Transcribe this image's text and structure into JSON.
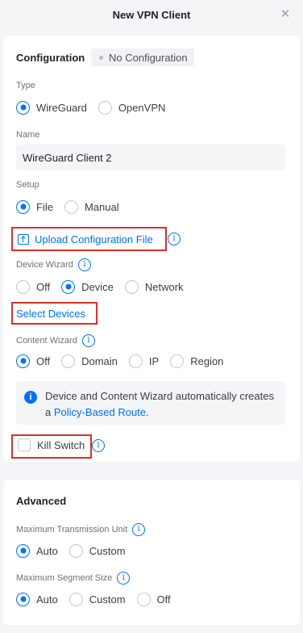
{
  "header": {
    "title": "New VPN Client",
    "close_icon": "close-icon"
  },
  "configuration": {
    "title": "Configuration",
    "status": "No Configuration",
    "type": {
      "label": "Type",
      "options": [
        "WireGuard",
        "OpenVPN"
      ],
      "selected": "WireGuard"
    },
    "name": {
      "label": "Name",
      "value": "WireGuard Client 2"
    },
    "setup": {
      "label": "Setup",
      "options": [
        "File",
        "Manual"
      ],
      "selected": "File"
    },
    "upload_link": "Upload Configuration File",
    "device_wizard": {
      "label": "Device Wizard",
      "options": [
        "Off",
        "Device",
        "Network"
      ],
      "selected": "Device"
    },
    "select_devices_link": "Select Devices",
    "content_wizard": {
      "label": "Content Wizard",
      "options": [
        "Off",
        "Domain",
        "IP",
        "Region"
      ],
      "selected": "Off"
    },
    "note": {
      "text": "Device and Content Wizard automatically creates a",
      "link": "Policy-Based Route",
      "end": "."
    },
    "kill_switch": {
      "label": "Kill Switch",
      "checked": false
    }
  },
  "advanced": {
    "title": "Advanced",
    "mtu": {
      "label": "Maximum Transmission Unit",
      "options": [
        "Auto",
        "Custom"
      ],
      "selected": "Auto"
    },
    "mss": {
      "label": "Maximum Segment Size",
      "options": [
        "Auto",
        "Custom",
        "Off"
      ],
      "selected": "Auto"
    }
  },
  "colors": {
    "accent": "#006fff",
    "highlight": "#e02b2b",
    "background": "#f4f5f7"
  }
}
